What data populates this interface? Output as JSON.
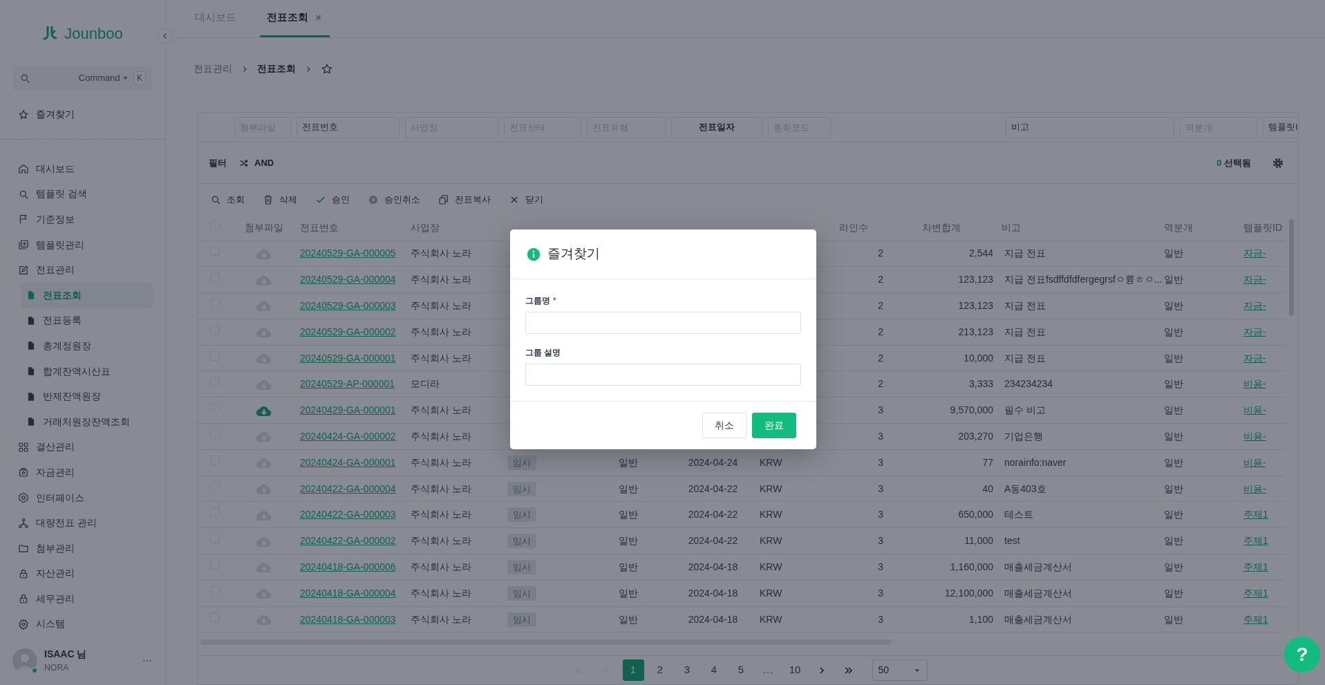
{
  "sidebar": {
    "logo": "Jounboo",
    "search": {
      "placeholder": "Command +",
      "shortcut": "K"
    },
    "favorites": "즐겨찾기",
    "items": [
      {
        "label": "대시보드",
        "selected": false
      },
      {
        "label": "템플릿 검색",
        "selected": false
      },
      {
        "label": "기준정보",
        "selected": false
      },
      {
        "label": "템플릿관리",
        "selected": false
      },
      {
        "label": "전표관리",
        "selected": false,
        "expanded": true,
        "children": [
          {
            "label": "전표조회",
            "selected": true
          },
          {
            "label": "전표등록",
            "selected": false
          },
          {
            "label": "총계정원장",
            "selected": false
          },
          {
            "label": "합계잔액시산표",
            "selected": false
          },
          {
            "label": "반제잔액원장",
            "selected": false
          },
          {
            "label": "거래처원장잔액조회",
            "selected": false
          }
        ]
      },
      {
        "label": "결산관리",
        "selected": false
      },
      {
        "label": "자금관리",
        "selected": false
      },
      {
        "label": "인터페이스",
        "selected": false
      },
      {
        "label": "대량전표 관리",
        "selected": false
      },
      {
        "label": "첨부관리",
        "selected": false
      },
      {
        "label": "자산관리",
        "selected": false
      },
      {
        "label": "세무관리",
        "selected": false
      },
      {
        "label": "시스템",
        "selected": false
      }
    ],
    "user": {
      "name": "ISAAC 님",
      "org": "NORA",
      "online": true
    }
  },
  "tabs": [
    {
      "label": "대시보드",
      "selected": false,
      "closable": false
    },
    {
      "label": "전표조회",
      "selected": true,
      "closable": true
    }
  ],
  "breadcrumb": [
    "전표관리",
    "전표조회"
  ],
  "filters": [
    {
      "kind": "input",
      "placeholder": "첨부파일"
    },
    {
      "kind": "input",
      "value": "전표번호"
    },
    {
      "kind": "input",
      "placeholder": "사업장"
    },
    {
      "kind": "input",
      "placeholder": "전표상태"
    },
    {
      "kind": "input",
      "placeholder": "전표유형"
    },
    {
      "kind": "button",
      "label": "전표일자"
    },
    {
      "kind": "input",
      "placeholder": "통화코드"
    },
    {
      "kind": "input",
      "value": "비고"
    },
    {
      "kind": "input",
      "placeholder": "역분개"
    },
    {
      "kind": "input",
      "value": "템플릿I"
    }
  ],
  "filter_bar": {
    "label": "필터",
    "mode": "AND",
    "selected_count": "0",
    "selected_label": "선택됨"
  },
  "toolbar": [
    {
      "label": "조회"
    },
    {
      "label": "삭제"
    },
    {
      "label": "승인"
    },
    {
      "label": "승인취소"
    },
    {
      "label": "전표복사"
    },
    {
      "label": "닫기"
    }
  ],
  "table": {
    "all_checked": false,
    "columns": {
      "attachment": "첨부파일",
      "voucher_no": "전표번호",
      "company": "사업장",
      "lines": "라인수",
      "debit_total": "차변합계",
      "memo": "비고",
      "reversal": "역분개",
      "template_id": "템플릿ID"
    },
    "rows": [
      {
        "checked": false,
        "attached": false,
        "voucher_no": "20240529-GA-000005",
        "company": "주식회사 노라",
        "lines": "2",
        "debit_total": "2,544",
        "memo": "지급 전표",
        "reversal": "일반",
        "template_id": "자금-"
      },
      {
        "checked": false,
        "attached": false,
        "voucher_no": "20240529-GA-000004",
        "company": "주식회사 노라",
        "lines": "2",
        "debit_total": "123,123",
        "memo": "지급 전표fsdffdfdfergegrsfㅇ륭ㅎㅇ...",
        "reversal": "일반",
        "template_id": "자금-"
      },
      {
        "checked": false,
        "attached": false,
        "voucher_no": "20240529-GA-000003",
        "company": "주식회사 노라",
        "lines": "2",
        "debit_total": "123,123",
        "memo": "지급 전표",
        "reversal": "일반",
        "template_id": "자금-"
      },
      {
        "checked": false,
        "attached": false,
        "voucher_no": "20240529-GA-000002",
        "company": "주식회사 노라",
        "lines": "2",
        "debit_total": "213,123",
        "memo": "지급 전표",
        "reversal": "일반",
        "template_id": "자금-"
      },
      {
        "checked": false,
        "attached": false,
        "voucher_no": "20240529-GA-000001",
        "company": "주식회사 노라",
        "lines": "2",
        "debit_total": "10,000",
        "memo": "지급 전표",
        "reversal": "일반",
        "template_id": "자금-"
      },
      {
        "checked": false,
        "attached": false,
        "voucher_no": "20240529-AP-000001",
        "company": "모디라",
        "lines": "2",
        "debit_total": "3,333",
        "memo": "234234234",
        "reversal": "일반",
        "template_id": "비용-"
      },
      {
        "checked": false,
        "attached": true,
        "voucher_no": "20240429-GA-000001",
        "company": "주식회사 노라",
        "lines": "3",
        "debit_total": "9,570,000",
        "memo": "필수 비고",
        "reversal": "일반",
        "template_id": "비용-"
      },
      {
        "checked": false,
        "attached": false,
        "voucher_no": "20240424-GA-000002",
        "company": "주식회사 노라",
        "lines": "3",
        "debit_total": "203,270",
        "memo": "기업은행",
        "reversal": "일반",
        "template_id": "비용-"
      },
      {
        "checked": false,
        "attached": false,
        "voucher_no": "20240424-GA-000001",
        "company": "주식회사 노라",
        "status": "임시",
        "type": "일반",
        "date": "2024-04-24",
        "currency": "KRW",
        "lines": "3",
        "debit_total": "77",
        "memo": "norainfo:naver",
        "reversal": "일반",
        "template_id": "비용-"
      },
      {
        "checked": false,
        "attached": false,
        "voucher_no": "20240422-GA-000004",
        "company": "주식회사 노라",
        "status": "임시",
        "type": "일반",
        "date": "2024-04-22",
        "currency": "KRW",
        "lines": "3",
        "debit_total": "40",
        "memo": "A동403호",
        "reversal": "일반",
        "template_id": "비용-"
      },
      {
        "checked": false,
        "attached": false,
        "voucher_no": "20240422-GA-000003",
        "company": "주식회사 노라",
        "status": "임시",
        "type": "일반",
        "date": "2024-04-22",
        "currency": "KRW",
        "lines": "3",
        "debit_total": "650,000",
        "memo": "테스트",
        "reversal": "일반",
        "template_id": "주제1"
      },
      {
        "checked": false,
        "attached": false,
        "voucher_no": "20240422-GA-000002",
        "company": "주식회사 노라",
        "status": "임시",
        "type": "일반",
        "date": "2024-04-22",
        "currency": "KRW",
        "lines": "3",
        "debit_total": "11,000",
        "memo": "test",
        "reversal": "일반",
        "template_id": "주제1"
      },
      {
        "checked": false,
        "attached": false,
        "voucher_no": "20240418-GA-000006",
        "company": "주식회사 노라",
        "status": "임시",
        "type": "일반",
        "date": "2024-04-18",
        "currency": "KRW",
        "lines": "3",
        "debit_total": "1,160,000",
        "memo": "매출세금계산서",
        "reversal": "일반",
        "template_id": "주제1"
      },
      {
        "checked": false,
        "attached": false,
        "voucher_no": "20240418-GA-000004",
        "company": "주식회사 노라",
        "status": "임시",
        "type": "일반",
        "date": "2024-04-18",
        "currency": "KRW",
        "lines": "3",
        "debit_total": "12,100,000",
        "memo": "매출세금계산서",
        "reversal": "일반",
        "template_id": "주제1"
      },
      {
        "checked": false,
        "attached": false,
        "voucher_no": "20240418-GA-000003",
        "company": "주식회사 노라",
        "status": "임시",
        "type": "일반",
        "date": "2024-04-18",
        "currency": "KRW",
        "lines": "3",
        "debit_total": "1,100",
        "memo": "매출세금계산서",
        "reversal": "일반",
        "template_id": "주제1"
      }
    ]
  },
  "pagination": {
    "nav": [
      {
        "kind": "first",
        "disabled": true
      },
      {
        "kind": "prev",
        "disabled": true
      },
      {
        "kind": "next",
        "disabled": false
      },
      {
        "kind": "last",
        "disabled": false
      }
    ],
    "pages": [
      {
        "label": "1",
        "selected": true
      },
      {
        "label": "2",
        "selected": false
      },
      {
        "label": "3",
        "selected": false
      },
      {
        "label": "4",
        "selected": false
      },
      {
        "label": "5",
        "selected": false
      }
    ],
    "ellipsis": "…",
    "last_pages": [
      {
        "label": "10",
        "selected": false
      }
    ],
    "page_size": "50"
  },
  "modal": {
    "title": "즐겨찾기",
    "fields": [
      {
        "label": "그룹명",
        "marker": "*"
      },
      {
        "label": "그룹 설명"
      }
    ],
    "buttons": [
      {
        "label": "취소",
        "kind": "secondary"
      },
      {
        "label": "완료",
        "kind": "primary"
      }
    ]
  },
  "help": "?"
}
